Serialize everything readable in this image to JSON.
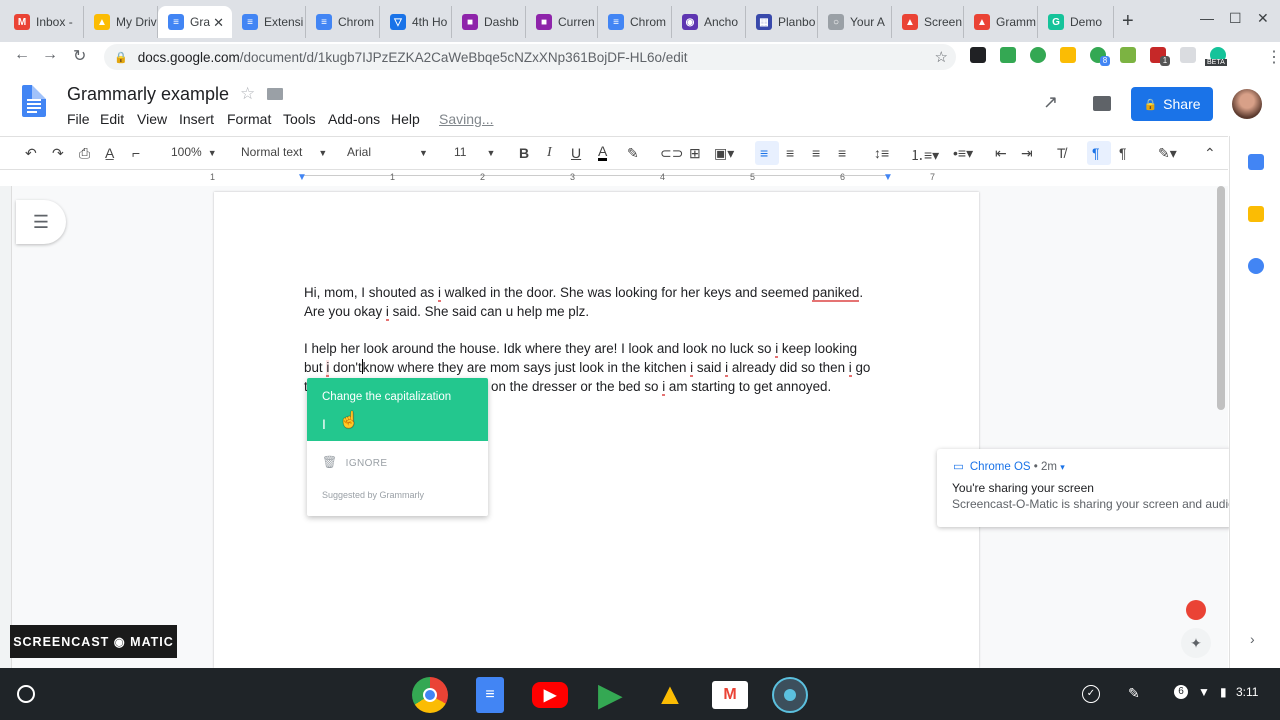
{
  "browser": {
    "tabs": [
      {
        "label": "Inbox -",
        "color": "#ea4335",
        "glyph": "M"
      },
      {
        "label": "My Drive",
        "color": "#fbbc04",
        "glyph": "▲"
      },
      {
        "label": "Gra",
        "color": "#4285f4",
        "glyph": "≡",
        "active": true
      },
      {
        "label": "Extensi",
        "color": "#4285f4",
        "glyph": "≡"
      },
      {
        "label": "Chrom",
        "color": "#4285f4",
        "glyph": "≡"
      },
      {
        "label": "4th Ho",
        "color": "#1a73e8",
        "glyph": "▽"
      },
      {
        "label": "Dashb",
        "color": "#8e24aa",
        "glyph": "■"
      },
      {
        "label": "Curren",
        "color": "#8e24aa",
        "glyph": "■"
      },
      {
        "label": "Chrom",
        "color": "#4285f4",
        "glyph": "≡"
      },
      {
        "label": "Ancho",
        "color": "#5e35b1",
        "glyph": "◉"
      },
      {
        "label": "Planbo",
        "color": "#3949ab",
        "glyph": "▦"
      },
      {
        "label": "Your A",
        "color": "#9aa0a6",
        "glyph": "○"
      },
      {
        "label": "Screen",
        "color": "#ea4335",
        "glyph": "▲"
      },
      {
        "label": "Gramm",
        "color": "#ea4335",
        "glyph": "▲"
      },
      {
        "label": "Demo",
        "color": "#15c39a",
        "glyph": "G"
      }
    ],
    "new_tab": "+",
    "close_tab": "✕",
    "window_controls": {
      "minimize": "—",
      "maximize": "☐",
      "close": "✕"
    },
    "url_host": "docs.google.com",
    "url_path": "/document/d/1kugb7IJPzEZKA2CaWeBbqe5cNZxXNp361BojDF-HL6o/edit",
    "beta_badge": "BETA",
    "ext_badge_1": "1",
    "ext_badge_2": "8"
  },
  "doc": {
    "title": "Grammarly example",
    "menu": [
      "File",
      "Edit",
      "View",
      "Insert",
      "Format",
      "Tools",
      "Add-ons",
      "Help"
    ],
    "saving": "Saving...",
    "share_label": "Share"
  },
  "toolbar": {
    "zoom": "100%",
    "style": "Normal text",
    "font": "Arial",
    "size": "11"
  },
  "ruler": [
    "1",
    "1",
    "2",
    "3",
    "4",
    "5",
    "6",
    "7"
  ],
  "content": {
    "p1_line1_a": "Hi, mom, I shouted as ",
    "p1_line1_err1": "i",
    "p1_line1_b": " walked in the door. She was looking for her keys and seemed ",
    "p1_line1_err2": "paniked",
    "p1_line1_c": ".",
    "p1_line2_a": "Are you okay ",
    "p1_line2_err": "i",
    "p1_line2_b": " said. She said can u help me plz.",
    "p2_line1_a": "I help her look around the house. Idk where they are! I look and look no luck so ",
    "p2_line1_err": "i",
    "p2_line1_b": " keep looking",
    "p2_line2_a": "but ",
    "p2_line2_err1": "i",
    "p2_line2_b": " don't",
    "p2_line2_c": "know where they are mom says just look in the kitchen ",
    "p2_line2_err2": "i",
    "p2_line2_d": " said ",
    "p2_line2_err3": "i",
    "p2_line2_e": " already did so then ",
    "p2_line2_err4": "i",
    "p2_line2_f": " go",
    "p2_line3_a": "t",
    "p2_line3_b": "on the dresser or the bed so ",
    "p2_line3_err": "i",
    "p2_line3_c": " am starting to get annoyed."
  },
  "grammarly": {
    "header": "Change the capitalization",
    "suggestion": "I",
    "ignore": "IGNORE",
    "footer": "Suggested by Grammarly",
    "accent": "#23c78e"
  },
  "notification": {
    "source": "Chrome OS",
    "time": "• 2m",
    "title": "You're sharing your screen",
    "body": "Screencast-O-Matic is sharing your screen and audio."
  },
  "watermark": "SCREENCAST ◉ MATIC",
  "shelf": {
    "tray_badge": "6",
    "time": "3:11"
  }
}
